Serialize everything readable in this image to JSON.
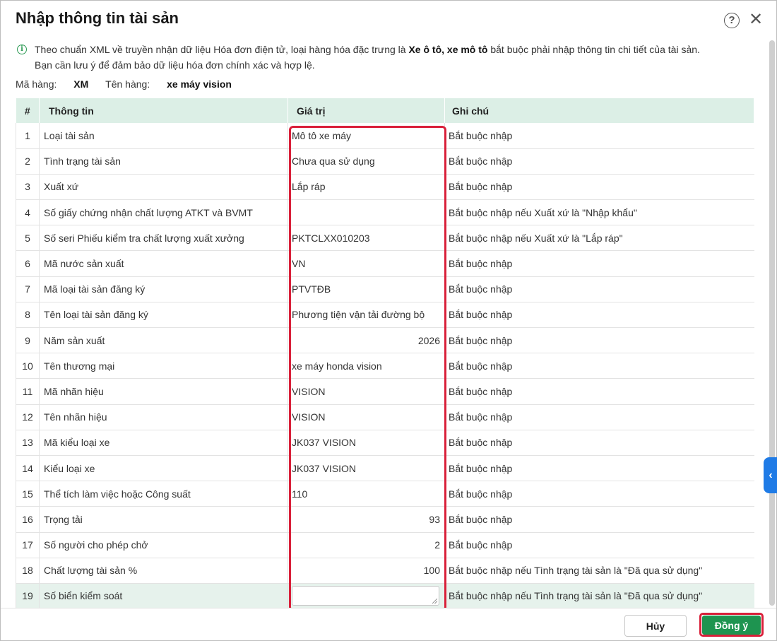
{
  "dialog": {
    "title": "Nhập thông tin tài sản",
    "help_glyph": "?",
    "close_glyph": "✕"
  },
  "notice": {
    "part1": "Theo chuẩn XML về truyền nhận dữ liệu Hóa đơn điện tử, loại hàng hóa đặc trưng là ",
    "bold": "Xe ô tô, xe mô tô",
    "part2": " bắt buộc phải nhập thông tin chi tiết của tài sản.",
    "line2": "Bạn cần lưu ý để đảm bảo dữ liệu hóa đơn chính xác và hợp lệ."
  },
  "meta": {
    "code_label": "Mã hàng:",
    "code_value": "XM",
    "name_label": "Tên hàng:",
    "name_value": "xe máy vision"
  },
  "table": {
    "headers": [
      "#",
      "Thông tin",
      "Giá trị",
      "Ghi chú"
    ],
    "rows": [
      {
        "idx": "1",
        "info": "Loại tài sản",
        "value": "Mô tô xe máy",
        "note": "Bắt buộc nhập"
      },
      {
        "idx": "2",
        "info": "Tình trạng tài sản",
        "value": "Chưa qua sử dụng",
        "note": "Bắt buộc nhập"
      },
      {
        "idx": "3",
        "info": "Xuất xứ",
        "value": "Lắp ráp",
        "note": "Bắt buộc nhập"
      },
      {
        "idx": "4",
        "info": "Số giấy chứng nhận chất lượng ATKT và BVMT",
        "value": "",
        "note": "Bắt buộc nhập nếu Xuất xứ là \"Nhập khẩu\""
      },
      {
        "idx": "5",
        "info": "Số seri Phiếu kiểm tra chất lượng xuất xưởng",
        "value": "PKTCLXX010203",
        "note": "Bắt buộc nhập nếu Xuất xứ là \"Lắp ráp\""
      },
      {
        "idx": "6",
        "info": "Mã nước sản xuất",
        "value": "VN",
        "note": "Bắt buộc nhập"
      },
      {
        "idx": "7",
        "info": "Mã loại tài sản đăng ký",
        "value": "PTVTĐB",
        "note": "Bắt buộc nhập"
      },
      {
        "idx": "8",
        "info": "Tên loại tài sản đăng ký",
        "value": "Phương tiện vận tải đường bộ",
        "note": "Bắt buộc nhập"
      },
      {
        "idx": "9",
        "info": "Năm sản xuất",
        "value": "2026",
        "note": "Bắt buộc nhập",
        "numeric": true
      },
      {
        "idx": "10",
        "info": "Tên thương mại",
        "value": "xe máy honda vision",
        "note": "Bắt buộc nhập"
      },
      {
        "idx": "11",
        "info": "Mã nhãn hiệu",
        "value": "VISION",
        "note": "Bắt buộc nhập"
      },
      {
        "idx": "12",
        "info": "Tên nhãn hiệu",
        "value": "VISION",
        "note": "Bắt buộc nhập"
      },
      {
        "idx": "13",
        "info": "Mã kiểu loại xe",
        "value": "JK037 VISION",
        "note": "Bắt buộc nhập"
      },
      {
        "idx": "14",
        "info": "Kiểu loại xe",
        "value": "JK037 VISION",
        "note": "Bắt buộc nhập"
      },
      {
        "idx": "15",
        "info": "Thể tích làm việc hoặc Công suất",
        "value": "110",
        "note": "Bắt buộc nhập"
      },
      {
        "idx": "16",
        "info": "Trọng tải",
        "value": "93",
        "note": "Bắt buộc nhập",
        "numeric": true
      },
      {
        "idx": "17",
        "info": "Số người cho phép chở",
        "value": "2",
        "note": "Bắt buộc nhập",
        "numeric": true
      },
      {
        "idx": "18",
        "info": "Chất lượng tài sản %",
        "value": "100",
        "note": "Bắt buộc nhập nếu Tình trạng tài sản là \"Đã qua sử dụng\"",
        "numeric": true
      },
      {
        "idx": "19",
        "info": "Số biển kiểm soát",
        "value": "",
        "note": "Bắt buộc nhập nếu Tình trạng tài sản là \"Đã qua sử dụng\"",
        "editing": true
      }
    ]
  },
  "side_tab_glyph": "‹",
  "footer": {
    "cancel_label": "Hủy",
    "ok_label": "Đồng ý"
  },
  "colors": {
    "header_bg": "#dcefe6",
    "accent_green": "#1e9450",
    "highlight_red": "#d9203a",
    "side_tab_blue": "#1f7be6"
  }
}
